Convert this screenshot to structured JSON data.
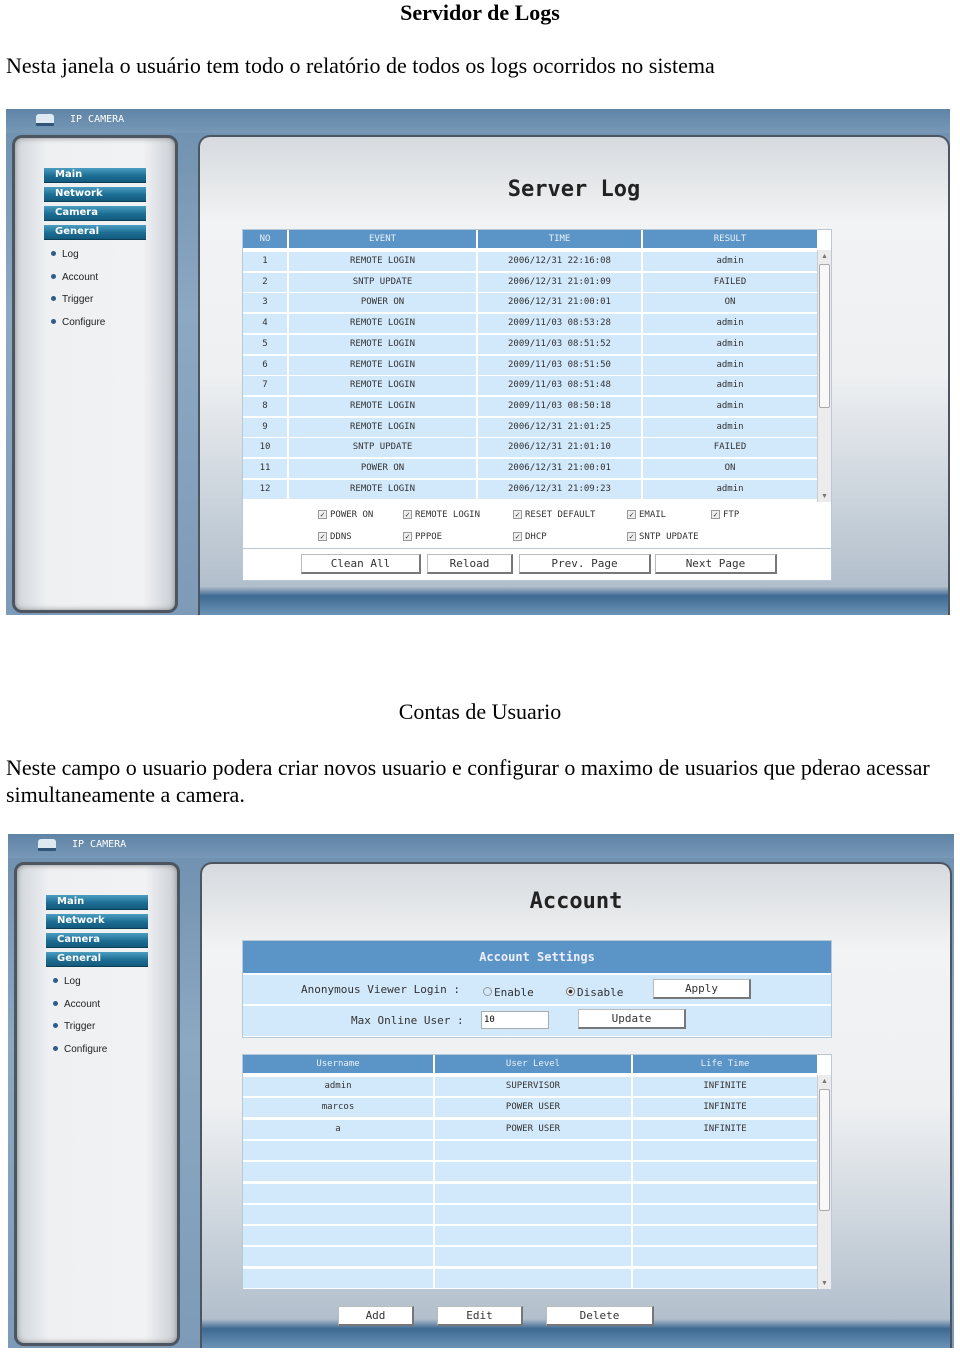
{
  "doc": {
    "title": "Servidor de Logs",
    "intro": "Nesta janela o usuário tem todo o relatório de todos os logs ocorridos no sistema",
    "section2_title": "Contas de Usuario",
    "section2_text": "Neste campo o usuario podera criar novos usuario e configurar o maximo de usuarios que pderao acessar simultaneamente a camera."
  },
  "app": {
    "title": "IP CAMERA",
    "menu": [
      "Main",
      "Network",
      "Camera",
      "General"
    ],
    "submenu": [
      "Log",
      "Account",
      "Trigger",
      "Configure"
    ]
  },
  "server_log": {
    "title": "Server Log",
    "columns": [
      "NO",
      "EVENT",
      "TIME",
      "RESULT"
    ],
    "rows": [
      [
        "1",
        "REMOTE LOGIN",
        "2006/12/31 22:16:08",
        "admin"
      ],
      [
        "2",
        "SNTP UPDATE",
        "2006/12/31 21:01:09",
        "FAILED"
      ],
      [
        "3",
        "POWER ON",
        "2006/12/31 21:00:01",
        "ON"
      ],
      [
        "4",
        "REMOTE LOGIN",
        "2009/11/03 08:53:28",
        "admin"
      ],
      [
        "5",
        "REMOTE LOGIN",
        "2009/11/03 08:51:52",
        "admin"
      ],
      [
        "6",
        "REMOTE LOGIN",
        "2009/11/03 08:51:50",
        "admin"
      ],
      [
        "7",
        "REMOTE LOGIN",
        "2009/11/03 08:51:48",
        "admin"
      ],
      [
        "8",
        "REMOTE LOGIN",
        "2009/11/03 08:50:18",
        "admin"
      ],
      [
        "9",
        "REMOTE LOGIN",
        "2006/12/31 21:01:25",
        "admin"
      ],
      [
        "10",
        "SNTP UPDATE",
        "2006/12/31 21:01:10",
        "FAILED"
      ],
      [
        "11",
        "POWER ON",
        "2006/12/31 21:00:01",
        "ON"
      ],
      [
        "12",
        "REMOTE LOGIN",
        "2006/12/31 21:09:23",
        "admin"
      ]
    ],
    "filters": [
      {
        "label": "POWER ON",
        "checked": true
      },
      {
        "label": "REMOTE LOGIN",
        "checked": true
      },
      {
        "label": "RESET DEFAULT",
        "checked": true
      },
      {
        "label": "EMAIL",
        "checked": true
      },
      {
        "label": "FTP",
        "checked": true
      },
      {
        "label": "DDNS",
        "checked": true
      },
      {
        "label": "PPPOE",
        "checked": true
      },
      {
        "label": "DHCP",
        "checked": true
      },
      {
        "label": "SNTP UPDATE",
        "checked": true
      }
    ],
    "buttons": [
      "Clean All",
      "Reload",
      "Prev. Page",
      "Next Page"
    ]
  },
  "account": {
    "title": "Account",
    "settings_title": "Account Settings",
    "anon_label": "Anonymous Viewer Login :",
    "enable_label": "Enable",
    "disable_label": "Disable",
    "anon_value": "Disable",
    "apply_label": "Apply",
    "max_label": "Max Online User :",
    "max_value": "10",
    "update_label": "Update",
    "columns": [
      "Username",
      "User Level",
      "Life Time"
    ],
    "rows": [
      [
        "admin",
        "SUPERVISOR",
        "INFINITE"
      ],
      [
        "marcos",
        "POWER USER",
        "INFINITE"
      ],
      [
        "a",
        "POWER USER",
        "INFINITE"
      ]
    ],
    "buttons": [
      "Add",
      "Edit",
      "Delete"
    ]
  }
}
